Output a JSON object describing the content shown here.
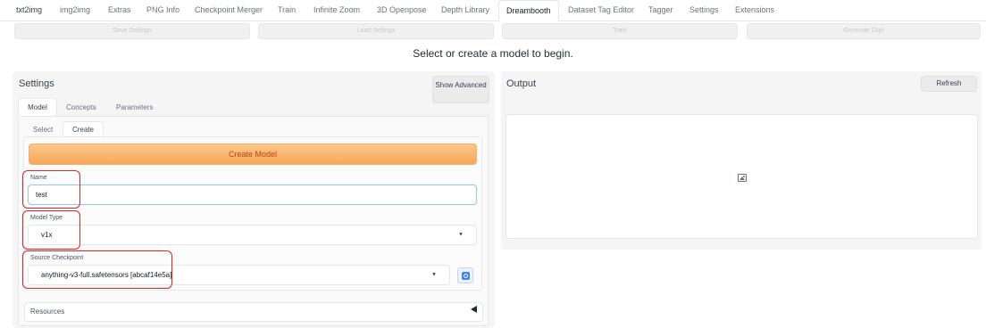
{
  "tabs": [
    "txt2img",
    "img2img",
    "Extras",
    "PNG Info",
    "Checkpoint Merger",
    "Train",
    "Infinite Zoom",
    "3D Openpose",
    "Depth Library",
    "Dreambooth",
    "Dataset Tag Editor",
    "Tagger",
    "Settings",
    "Extensions"
  ],
  "active_tab": "Dreambooth",
  "actions": [
    "Save Settings",
    "Load Settings",
    "Train",
    "Generate Ckpt"
  ],
  "status_message": "Select or create a model to begin.",
  "settings": {
    "title": "Settings",
    "show_advanced": "Show Advanced",
    "subtabs": [
      "Model",
      "Concepts",
      "Parameters"
    ],
    "model_tabs": [
      "Select",
      "Create"
    ],
    "create_button": "Create Model",
    "name_label": "Name",
    "name_value": "test",
    "model_type_label": "Model Type",
    "model_type_value": "v1x",
    "source_checkpoint_label": "Source Checkpoint",
    "source_checkpoint_value": "anything-v3-full.safetensors [abcaf14e5a]",
    "resources_label": "Resources"
  },
  "output": {
    "title": "Output",
    "refresh": "Refresh"
  },
  "icons": {
    "dropdown": "chevron-down-icon",
    "sync": "refresh-icon",
    "accordion": "triangle-left-icon",
    "placeholder": "image-icon"
  },
  "colors": {
    "create_button_bg": "#f6a85a",
    "create_button_text": "#c2410c",
    "highlight_box": "#dc2626",
    "focus_border": "#93c5fd"
  }
}
